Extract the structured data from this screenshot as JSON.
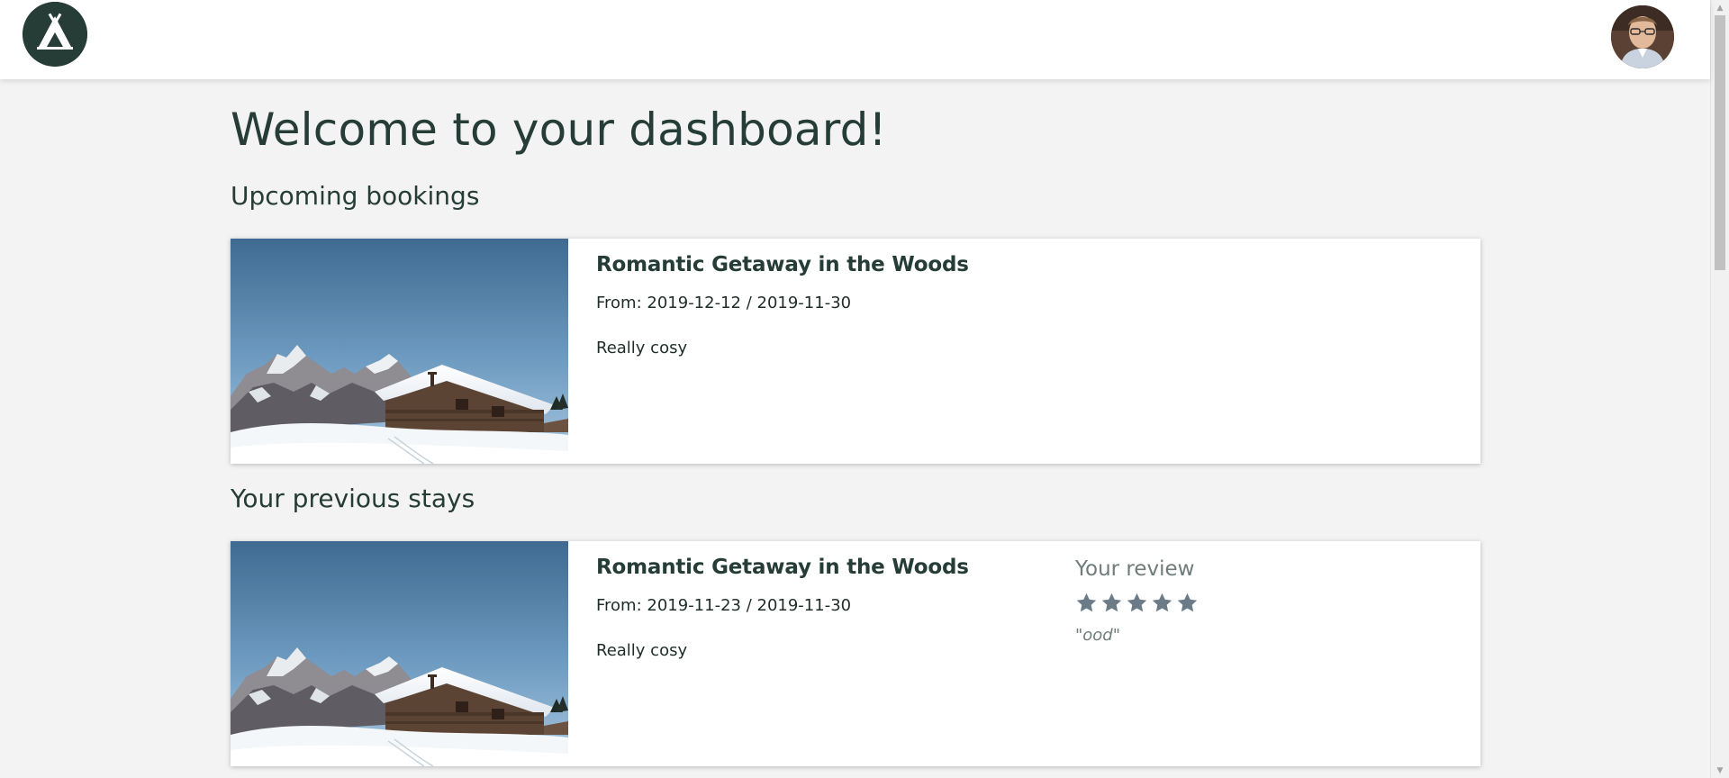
{
  "header": {
    "logo_icon": "tent-logo-icon",
    "avatar_icon": "user-avatar"
  },
  "main": {
    "title": "Welcome to your dashboard!",
    "upcoming": {
      "heading": "Upcoming bookings",
      "items": [
        {
          "title": "Romantic Getaway in the Woods",
          "dates": "From: 2019-12-12 / 2019-11-30",
          "description": "Really cosy",
          "image_icon": "snowy-cabin-image"
        }
      ]
    },
    "previous": {
      "heading": "Your previous stays",
      "items": [
        {
          "title": "Romantic Getaway in the Woods",
          "dates": "From: 2019-11-23 / 2019-11-30",
          "description": "Really cosy",
          "image_icon": "snowy-cabin-image",
          "review": {
            "heading": "Your review",
            "rating": 5,
            "max_rating": 5,
            "quote": "\"ood\""
          }
        }
      ]
    }
  },
  "colors": {
    "brand": "#263c36",
    "background": "#f3f3f3",
    "star": "#6b7b87",
    "muted_text": "#6f7c7a"
  }
}
